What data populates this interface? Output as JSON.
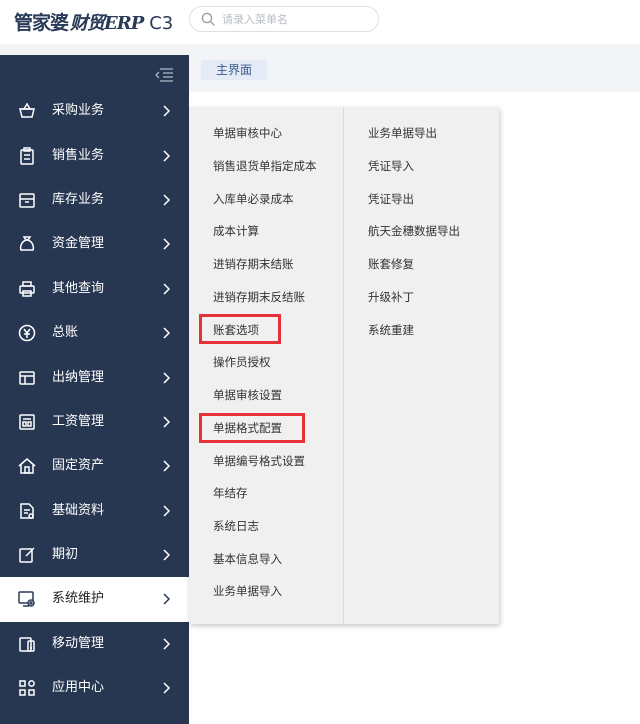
{
  "header": {
    "logo_brand": "管家婆",
    "logo_product": "财贸ERP",
    "logo_version": "C3",
    "search_placeholder": "请录入菜单名"
  },
  "sidebar": {
    "items": [
      {
        "label": "采购业务",
        "icon": "shopping-basket-icon",
        "active": false
      },
      {
        "label": "销售业务",
        "icon": "clipboard-icon",
        "active": false
      },
      {
        "label": "库存业务",
        "icon": "inventory-box-icon",
        "active": false
      },
      {
        "label": "资金管理",
        "icon": "money-bag-icon",
        "active": false
      },
      {
        "label": "其他查询",
        "icon": "printer-icon",
        "active": false
      },
      {
        "label": "总账",
        "icon": "yen-icon",
        "active": false
      },
      {
        "label": "出纳管理",
        "icon": "cashier-layout-icon",
        "active": false
      },
      {
        "label": "工资管理",
        "icon": "salary-document-icon",
        "active": false
      },
      {
        "label": "固定资产",
        "icon": "house-icon",
        "active": false
      },
      {
        "label": "基础资料",
        "icon": "data-file-icon",
        "active": false
      },
      {
        "label": "期初",
        "icon": "edit-icon",
        "active": false
      },
      {
        "label": "系统维护",
        "icon": "system-maintenance-icon",
        "active": true
      },
      {
        "label": "移动管理",
        "icon": "mobile-icon",
        "active": false
      },
      {
        "label": "应用中心",
        "icon": "app-grid-icon",
        "active": false
      }
    ]
  },
  "tabs": [
    {
      "label": "主界面"
    }
  ],
  "dropdown": {
    "left_column": [
      "单据审核中心",
      "销售退货单指定成本",
      "入库单必录成本",
      "成本计算",
      "进销存期末结账",
      "进销存期末反结账",
      "账套选项",
      "操作员授权",
      "单据审核设置",
      "单据格式配置",
      "单据编号格式设置",
      "年结存",
      "系统日志",
      "基本信息导入",
      "业务单据导入"
    ],
    "right_column": [
      "业务单据导出",
      "凭证导入",
      "凭证导出",
      "航天金穗数据导出",
      "账套修复",
      "升级补丁",
      "系统重建"
    ]
  },
  "colors": {
    "sidebar_bg": "#273752",
    "highlight": "#e53238",
    "tab_bg": "#e4ebf7"
  }
}
